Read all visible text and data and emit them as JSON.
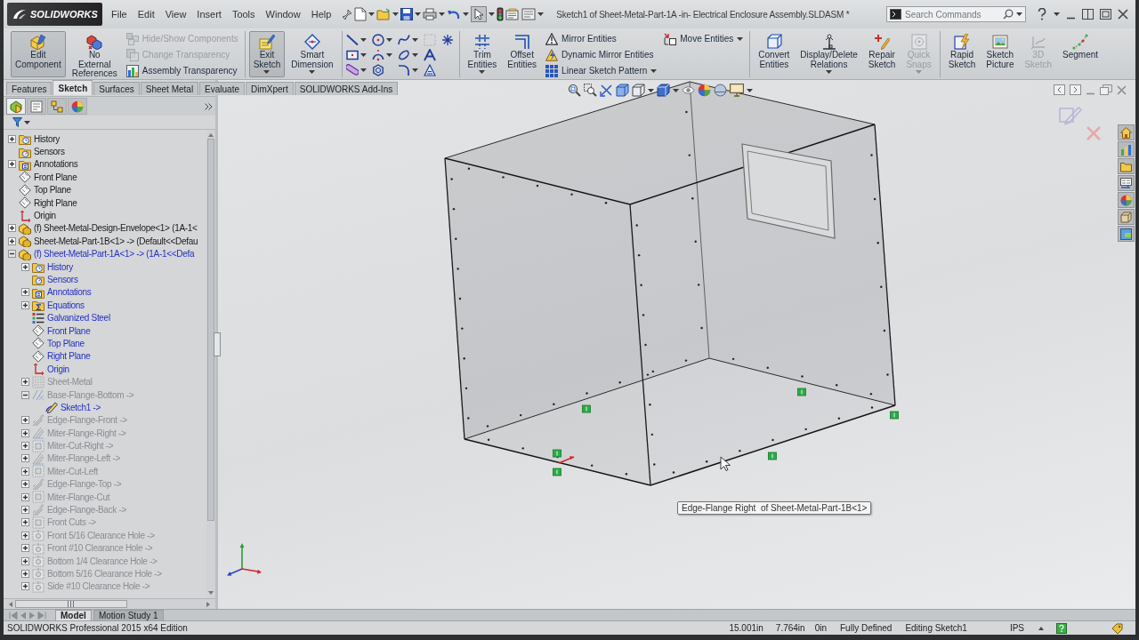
{
  "window": {
    "title": "Sketch1 of Sheet-Metal-Part-1A -in- Electrical Enclosure Assembly.SLDASM *"
  },
  "logo": {
    "text": "SOLIDWORKS"
  },
  "menu": [
    "File",
    "Edit",
    "View",
    "Insert",
    "Tools",
    "Window",
    "Help"
  ],
  "search": {
    "placeholder": "Search Commands"
  },
  "ribbon": {
    "groups": [
      {
        "items": [
          {
            "kind": "large",
            "label": "Edit\nComponent",
            "active": true,
            "disabled": false,
            "dropdown": false
          },
          {
            "kind": "large",
            "label": "No\nExternal\nReferences",
            "active": false,
            "disabled": false,
            "dropdown": false
          },
          {
            "kind": "stack",
            "items": [
              {
                "label": "Hide/Show Components",
                "disabled": true,
                "dropdown": false
              },
              {
                "label": "Change Transparency",
                "disabled": true,
                "dropdown": false
              },
              {
                "label": "Assembly Transparency",
                "disabled": false,
                "dropdown": false
              }
            ]
          }
        ]
      },
      {
        "items": [
          {
            "kind": "large",
            "label": "Exit\nSketch",
            "active": true,
            "disabled": false,
            "dropdown": true
          },
          {
            "kind": "large",
            "label": "Smart\nDimension",
            "active": false,
            "disabled": false,
            "dropdown": true
          }
        ]
      },
      {
        "items": [
          {
            "kind": "tools",
            "rows": [
              [
                {
                  "dropdown": true,
                  "disabled": false
                },
                {
                  "dropdown": true,
                  "disabled": false
                },
                {
                  "dropdown": true,
                  "disabled": false
                },
                {
                  "dropdown": false,
                  "disabled": true
                },
                {
                  "dropdown": false,
                  "disabled": false
                }
              ],
              [
                {
                  "dropdown": true,
                  "disabled": false
                },
                {
                  "dropdown": true,
                  "disabled": false
                },
                {
                  "dropdown": true,
                  "disabled": false
                },
                {
                  "dropdown": false,
                  "disabled": false
                }
              ],
              [
                {
                  "dropdown": true,
                  "disabled": false
                },
                {
                  "dropdown": false,
                  "disabled": false
                },
                {
                  "dropdown": true,
                  "disabled": false
                },
                {
                  "dropdown": false,
                  "disabled": false
                }
              ]
            ]
          }
        ]
      },
      {
        "items": [
          {
            "kind": "large",
            "label": "Trim\nEntities",
            "active": false,
            "disabled": false,
            "dropdown": true
          },
          {
            "kind": "large",
            "label": "Offset\nEntities",
            "active": false,
            "disabled": false,
            "dropdown": false
          },
          {
            "kind": "stack",
            "items": [
              {
                "label": "Mirror Entities",
                "disabled": false,
                "dropdown": false
              },
              {
                "label": "Dynamic Mirror Entities",
                "disabled": false,
                "dropdown": false
              },
              {
                "label": "Linear Sketch Pattern",
                "disabled": false,
                "dropdown": true
              }
            ]
          },
          {
            "kind": "stack",
            "items": [
              {
                "label": "Move Entities",
                "disabled": false,
                "dropdown": true
              }
            ]
          }
        ]
      },
      {
        "items": [
          {
            "kind": "large",
            "label": "Convert\nEntities",
            "active": false,
            "disabled": false,
            "dropdown": false
          },
          {
            "kind": "large",
            "label": "Display/Delete\nRelations",
            "active": false,
            "disabled": false,
            "dropdown": true
          },
          {
            "kind": "large",
            "label": "Repair\nSketch",
            "active": false,
            "disabled": false,
            "dropdown": false
          },
          {
            "kind": "large",
            "label": "Quick\nSnaps",
            "active": false,
            "disabled": true,
            "dropdown": true
          }
        ]
      },
      {
        "items": [
          {
            "kind": "large",
            "label": "Rapid\nSketch",
            "active": false,
            "disabled": false,
            "dropdown": false
          },
          {
            "kind": "large",
            "label": "Sketch\nPicture",
            "active": false,
            "disabled": false,
            "dropdown": false
          },
          {
            "kind": "large",
            "label": "3D\nSketch",
            "active": false,
            "disabled": true,
            "dropdown": false
          },
          {
            "kind": "large",
            "label": "Segment",
            "active": false,
            "disabled": false,
            "dropdown": false
          }
        ]
      }
    ]
  },
  "command_tabs": [
    {
      "label": "Features",
      "selected": false
    },
    {
      "label": "Sketch",
      "selected": true
    },
    {
      "label": "Surfaces",
      "selected": false
    },
    {
      "label": "Sheet Metal",
      "selected": false
    },
    {
      "label": "Evaluate",
      "selected": false
    },
    {
      "label": "DimXpert",
      "selected": false
    },
    {
      "label": "SOLIDWORKS Add-Ins",
      "selected": false
    }
  ],
  "feature_manager": {
    "tabs": [
      {
        "selected": true
      },
      {
        "selected": false
      },
      {
        "selected": false
      },
      {
        "selected": false
      }
    ],
    "tree": [
      {
        "label": "History",
        "kind": "history",
        "expander": true,
        "expanded": false,
        "editing": false,
        "rolled_back": false
      },
      {
        "label": "Sensors",
        "kind": "sensors",
        "expander": false,
        "editing": false,
        "rolled_back": false
      },
      {
        "label": "Annotations",
        "kind": "annotations",
        "expander": true,
        "expanded": false,
        "editing": false,
        "rolled_back": false
      },
      {
        "label": "Front Plane",
        "kind": "plane",
        "expander": false,
        "editing": false,
        "rolled_back": false
      },
      {
        "label": "Top Plane",
        "kind": "plane",
        "expander": false,
        "editing": false,
        "rolled_back": false
      },
      {
        "label": "Right Plane",
        "kind": "plane",
        "expander": false,
        "editing": false,
        "rolled_back": false
      },
      {
        "label": "Origin",
        "kind": "origin",
        "expander": false,
        "editing": false,
        "rolled_back": false
      },
      {
        "label": "(f) Sheet-Metal-Design-Envelope<1> (1A-1<",
        "kind": "component",
        "expander": true,
        "expanded": false,
        "editing": false,
        "rolled_back": false
      },
      {
        "label": "Sheet-Metal-Part-1B<1> -> (Default<<Defau",
        "kind": "component",
        "expander": true,
        "expanded": false,
        "editing": false,
        "rolled_back": false
      },
      {
        "label": "(f) Sheet-Metal-Part-1A<1> -> (1A-1<<Defa",
        "kind": "component",
        "expander": true,
        "expanded": true,
        "editing": true,
        "rolled_back": false,
        "children": [
          {
            "label": "History",
            "kind": "history",
            "expander": true,
            "expanded": false,
            "editing": true,
            "rolled_back": false
          },
          {
            "label": "Sensors",
            "kind": "sensors",
            "expander": false,
            "editing": true,
            "rolled_back": false
          },
          {
            "label": "Annotations",
            "kind": "annotations",
            "expander": true,
            "expanded": false,
            "editing": true,
            "rolled_back": false
          },
          {
            "label": "Equations",
            "kind": "equations",
            "expander": true,
            "expanded": false,
            "editing": true,
            "rolled_back": false
          },
          {
            "label": "Galvanized Steel",
            "kind": "material",
            "expander": false,
            "editing": true,
            "rolled_back": false
          },
          {
            "label": "Front Plane",
            "kind": "plane",
            "expander": false,
            "editing": true,
            "rolled_back": false
          },
          {
            "label": "Top Plane",
            "kind": "plane",
            "expander": false,
            "editing": true,
            "rolled_back": false
          },
          {
            "label": "Right Plane",
            "kind": "plane",
            "expander": false,
            "editing": true,
            "rolled_back": false
          },
          {
            "label": "Origin",
            "kind": "origin",
            "expander": false,
            "editing": true,
            "rolled_back": false
          },
          {
            "label": "Sheet-Metal",
            "kind": "sheet-metal",
            "expander": true,
            "expanded": false,
            "editing": false,
            "rolled_back": true
          },
          {
            "label": "Base-Flange-Bottom ->",
            "kind": "base-flange",
            "expander": true,
            "expanded": true,
            "editing": false,
            "rolled_back": true,
            "children": [
              {
                "label": "Sketch1 ->",
                "kind": "sketch",
                "expander": false,
                "editing": true,
                "rolled_back": false
              }
            ]
          },
          {
            "label": "Edge-Flange-Front ->",
            "kind": "edge-flange",
            "expander": true,
            "expanded": false,
            "editing": false,
            "rolled_back": true
          },
          {
            "label": "Miter-Flange-Right ->",
            "kind": "miter-flange",
            "expander": true,
            "expanded": false,
            "editing": false,
            "rolled_back": true
          },
          {
            "label": "Miter-Cut-Right ->",
            "kind": "cut",
            "expander": true,
            "expanded": false,
            "editing": false,
            "rolled_back": true
          },
          {
            "label": "Miter-Flange-Left ->",
            "kind": "miter-flange",
            "expander": true,
            "expanded": false,
            "editing": false,
            "rolled_back": true
          },
          {
            "label": "Miter-Cut-Left",
            "kind": "cut",
            "expander": true,
            "expanded": false,
            "editing": false,
            "rolled_back": true
          },
          {
            "label": "Edge-Flange-Top ->",
            "kind": "edge-flange",
            "expander": true,
            "expanded": false,
            "editing": false,
            "rolled_back": true
          },
          {
            "label": "Miter-Flange-Cut",
            "kind": "cut",
            "expander": true,
            "expanded": false,
            "editing": false,
            "rolled_back": true
          },
          {
            "label": "Edge-Flange-Back ->",
            "kind": "edge-flange",
            "expander": true,
            "expanded": false,
            "editing": false,
            "rolled_back": true
          },
          {
            "label": "Front Cuts ->",
            "kind": "cut",
            "expander": true,
            "expanded": false,
            "editing": false,
            "rolled_back": true
          },
          {
            "label": "Front 5/16 Clearance Hole ->",
            "kind": "hole",
            "expander": true,
            "expanded": false,
            "editing": false,
            "rolled_back": true
          },
          {
            "label": "Front #10 Clearance Hole ->",
            "kind": "hole",
            "expander": true,
            "expanded": false,
            "editing": false,
            "rolled_back": true
          },
          {
            "label": "Bottom 1/4 Clearance Hole ->",
            "kind": "hole",
            "expander": true,
            "expanded": false,
            "editing": false,
            "rolled_back": true
          },
          {
            "label": "Bottom 5/16 Clearance Hole ->",
            "kind": "hole",
            "expander": true,
            "expanded": false,
            "editing": false,
            "rolled_back": true
          },
          {
            "label": "Side #10 Clearance Hole ->",
            "kind": "hole",
            "expander": true,
            "expanded": false,
            "editing": false,
            "rolled_back": true
          }
        ]
      }
    ]
  },
  "viewport": {
    "tooltip": "Edge-Flange Right  of Sheet-Metal-Part-1B<1>"
  },
  "bottom_tabs": [
    {
      "label": "Model",
      "selected": true
    },
    {
      "label": "Motion Study 1",
      "selected": false
    }
  ],
  "status_bar": {
    "product": "SOLIDWORKS Professional 2015 x64 Edition",
    "coordinates": [
      "15.001in",
      "7.764in",
      "0in"
    ],
    "sketch_status": "Fully Defined",
    "mode": "Editing Sketch1",
    "units": "IPS"
  }
}
